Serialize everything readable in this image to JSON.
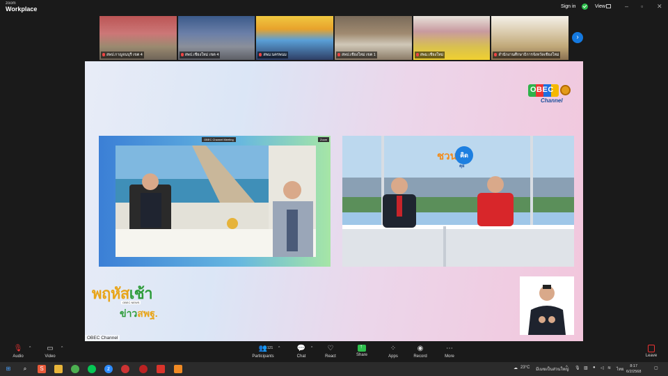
{
  "titlebar": {
    "brand_small": "zoom",
    "brand_main": "Workplace",
    "signin": "Sign in",
    "view": "View"
  },
  "thumbnails": [
    {
      "label": "สพป.กาญจนบุรี เขต 4"
    },
    {
      "label": "สพป.เชียงใหม่ เขต 4"
    },
    {
      "label": "สพม.นครพนม"
    },
    {
      "label": "สพป.เชียงใหม่ เขต 1"
    },
    {
      "label": "สพม.เชียงใหม่"
    },
    {
      "label": "สำนักงานศึกษาธิการจังหวัดเชียงใหม่"
    }
  ],
  "stage": {
    "obec_logo": "OBEC",
    "obec_sub": "Channel",
    "show_word1": "ชวน",
    "show_word2": "คิด",
    "show_word3": "คุย",
    "news_line1": "พฤหัส",
    "news_line1b": "เช้า",
    "news_line2": "OBEC NEWS",
    "news_line3a": "ข่าว",
    "news_line3b": "สพฐ.",
    "channel_tag": "OBEC Channel",
    "inner_tag": "OBEC Channel Meeting",
    "inner_tag2": "Zoom"
  },
  "toolbar": {
    "audio": "Audio",
    "video": "Video",
    "participants": "Participants",
    "participants_count": "121",
    "chat": "Chat",
    "react": "React",
    "share": "Share",
    "apps": "Apps",
    "record": "Record",
    "more": "More",
    "leave": "Leave"
  },
  "taskbar": {
    "weather": "23°C",
    "weather_text": "มีเมฆเป็นส่วนใหญ่",
    "lang": "ไทย",
    "time": "8:17",
    "date": "6/2/2568"
  },
  "colors": {
    "accent_blue": "#1479e0",
    "share_green": "#2fbf4d",
    "leave_red": "#e33333"
  }
}
